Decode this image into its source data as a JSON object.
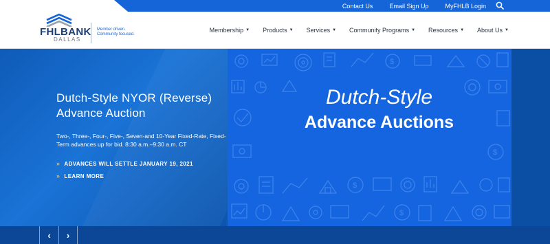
{
  "utility_nav": {
    "links": [
      "Contact Us",
      "Email Sign Up",
      "MyFHLB Login"
    ],
    "search_icon": "search-icon"
  },
  "logo": {
    "name": "FHLBANK",
    "sub": "DALLAS",
    "tagline": "Member driven. Community focused."
  },
  "main_nav": {
    "items": [
      "Membership",
      "Products",
      "Services",
      "Community Programs",
      "Resources",
      "About Us"
    ]
  },
  "hero": {
    "title": "Dutch-Style NYOR (Reverse) Advance Auction",
    "description": "Two-, Three-, Four-, Five-, Seven-and 10-Year Fixed-Rate, Fixed-Term advances up for bid. 8:30 a.m.–9:30 a.m. CT",
    "cta_primary": "ADVANCES WILL SETTLE JANUARY 19, 2021",
    "cta_secondary": "LEARN MORE",
    "cta_icon": "»",
    "panel_line1": "Dutch-Style",
    "panel_line2": "Advance Auctions"
  },
  "carousel": {
    "prev_icon": "‹",
    "next_icon": "›"
  },
  "colors": {
    "brand_blue": "#1565d8",
    "navy": "#1c3f74",
    "accent_gold": "#f7b733"
  }
}
